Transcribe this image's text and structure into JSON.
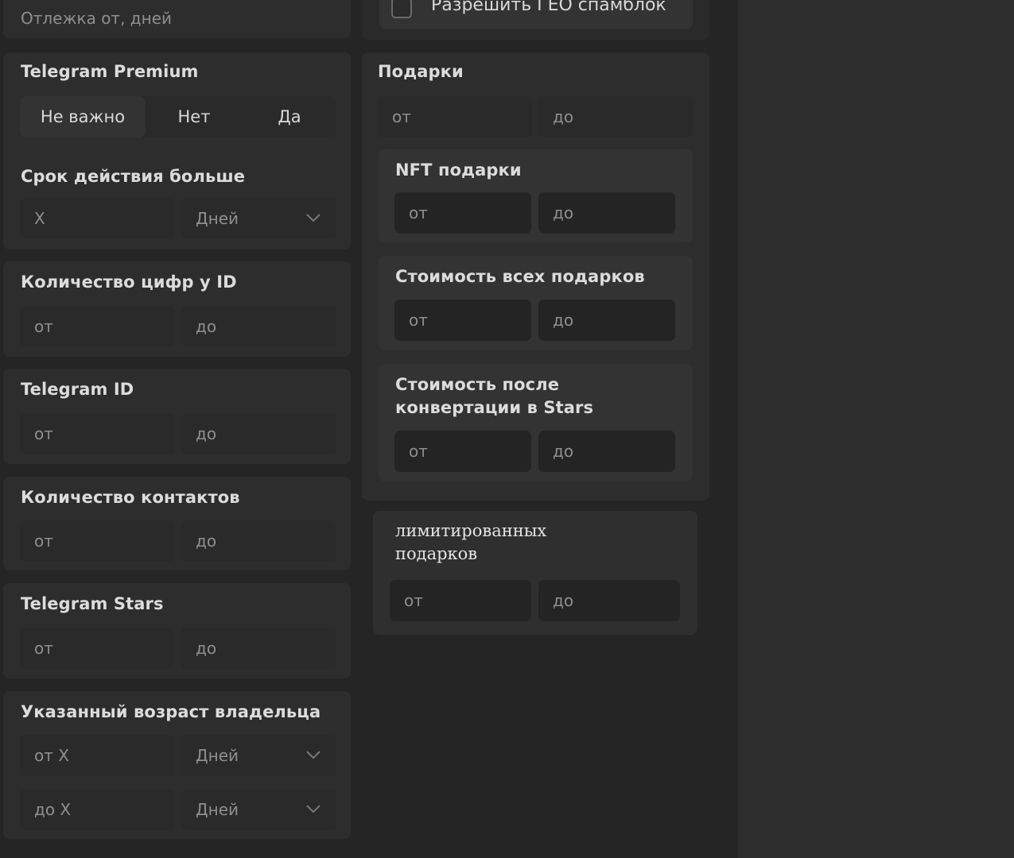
{
  "top": {
    "tracking_placeholder": "Отлежка от, дней",
    "geo_spamblock_label": "Разрешить ГЕО спамблок"
  },
  "premium": {
    "title": "Telegram Premium",
    "options": [
      "Не важно",
      "Нет",
      "Да"
    ],
    "selected": "Не важно"
  },
  "validity": {
    "title": "Срок действия больше",
    "value_placeholder": "X",
    "unit": "Дней"
  },
  "id_digits": {
    "title": "Количество цифр у ID",
    "from": "от",
    "to": "до"
  },
  "telegram_id": {
    "title": "Telegram ID",
    "from": "от",
    "to": "до"
  },
  "contacts": {
    "title": "Количество контактов",
    "from": "от",
    "to": "до"
  },
  "stars": {
    "title": "Telegram Stars",
    "from": "от",
    "to": "до"
  },
  "owner_age": {
    "title": "Указанный возраст владельца",
    "from_placeholder": "от X",
    "to_placeholder": "до X",
    "unit_from": "Дней",
    "unit_to": "Дней"
  },
  "gifts": {
    "title": "Подарки",
    "from": "от",
    "to": "до",
    "nft": {
      "title": "NFT подарки",
      "from": "от",
      "to": "до"
    },
    "total_cost": {
      "title": "Стоимость всех подарков",
      "from": "от",
      "to": "до"
    },
    "stars_cost": {
      "title_line1": "Стоимость после",
      "title_line2": "конвертации в Stars",
      "from": "от",
      "to": "до"
    }
  },
  "limited": {
    "title_line1": "лимитированных",
    "title_line2": "подарков",
    "from": "от",
    "to": "до"
  },
  "colors": {
    "background": "#252525",
    "panel": "#2d2d2d",
    "field": "#2a2a2a",
    "text": "#d6d6d6",
    "placeholder": "#8f8f8f"
  }
}
